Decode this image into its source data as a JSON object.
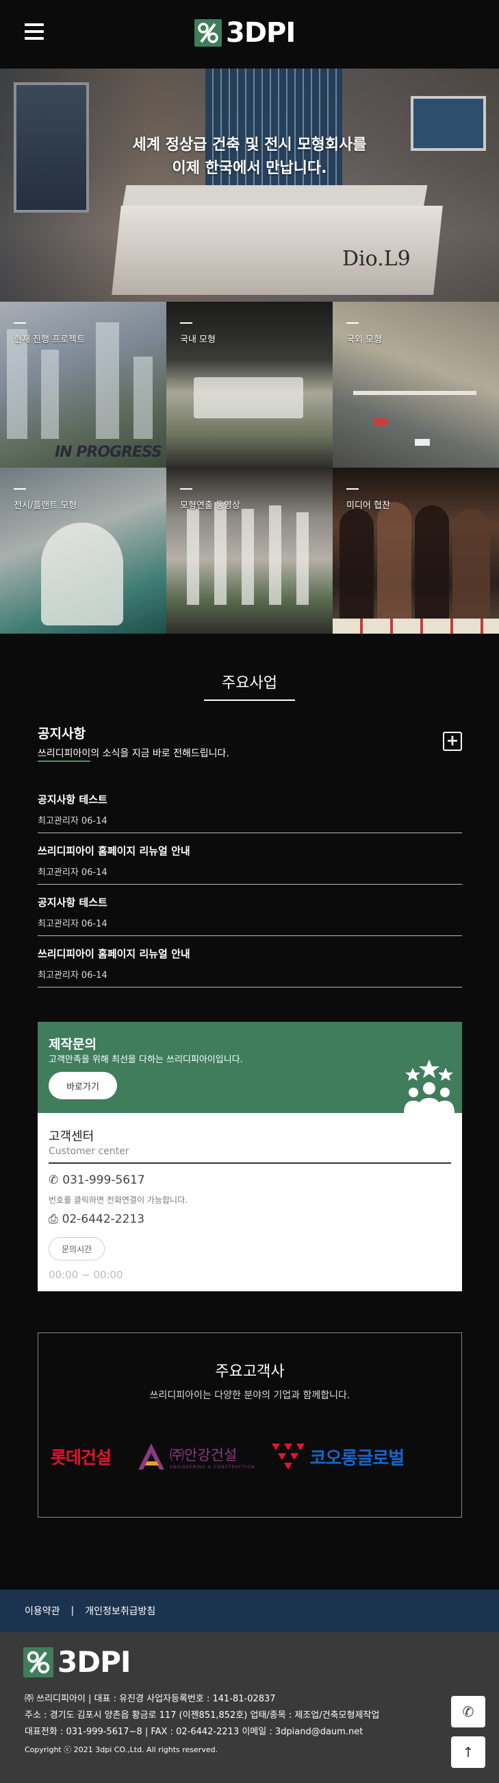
{
  "header": {
    "logo_text": "3DPI"
  },
  "hero": {
    "line1": "세계 정상급 건축 및 전시 모형회사를",
    "line2": "이제 한국에서 만납니다.",
    "brand_sign": "Dio.L9"
  },
  "tiles": [
    {
      "label": "현재 진행 프로젝트",
      "overlay": "IN PROGRESS"
    },
    {
      "label": "국내 모형"
    },
    {
      "label": "국외 모형"
    },
    {
      "label": "전시/플랜트 모형"
    },
    {
      "label": "모형연출 동영상"
    },
    {
      "label": "미디어 협찬"
    }
  ],
  "business": {
    "title": "주요사업"
  },
  "notice": {
    "title": "공지사항",
    "subtitle_highlight": "쓰리디피아이",
    "subtitle_rest": "의 소식을 지금 바로 전해드립니다.",
    "plus": "+",
    "items": [
      {
        "title": "공지사항 테스트",
        "meta": "최고관리자 06-14"
      },
      {
        "title": "쓰리디피아이 홈페이지 리뉴얼 안내",
        "meta": "최고관리자 06-14"
      },
      {
        "title": "공지사항 테스트",
        "meta": "최고관리자 06-14"
      },
      {
        "title": "쓰리디피아이 홈페이지 리뉴얼 안내",
        "meta": "최고관리자 06-14"
      }
    ]
  },
  "inquiry": {
    "title": "제작문의",
    "subtitle": "고객만족을 위해 최선을 다하는 쓰리디피아이입니다.",
    "button": "바로가기"
  },
  "customer_center": {
    "title": "고객센터",
    "subtitle": "Customer center",
    "phone": "031-999-5617",
    "phone_note": "번호를 클릭하면 전화연결이 가능합니다.",
    "fax": "02-6442-2213",
    "hours_label": "문의시간",
    "hours": "00:00 ~ 00:00"
  },
  "clients": {
    "title": "주요고객사",
    "subtitle": "쓰리디피아이는 다양한 분야의 기업과 함께합니다.",
    "logos": {
      "lotte": "롯데건설",
      "anyang": "㈜안강건설",
      "anyang_eng": "ENGINEERING & CONSTRUCTION",
      "kolon": "코오롱글로벌"
    }
  },
  "footer": {
    "terms": "이용약관",
    "privacy": "개인정보취급방침",
    "logo_text": "3DPI",
    "info_line1": "㈜ 쓰리디피아이 | 대표 : 유진경 사업자등록번호 : 141-81-02837",
    "info_line2": "주소 : 경기도 김포시 양촌읍 황금로 117 (이젠851,852호) 업태/종목 : 제조업/건축모형제작업",
    "info_line3": "대표전화 : 031-999-5617~8 | FAX : 02-6442-2213 이메일 : 3dpiand@daum.net",
    "copyright": "Copyright ⓒ 2021 3dpi CO.,Ltd. All rights reserved."
  },
  "colors": {
    "accent_green": "#3f7d5c",
    "footer_bar": "#1c3350",
    "lotte_red": "#e3142d",
    "kolon_blue": "#1a64c8"
  }
}
